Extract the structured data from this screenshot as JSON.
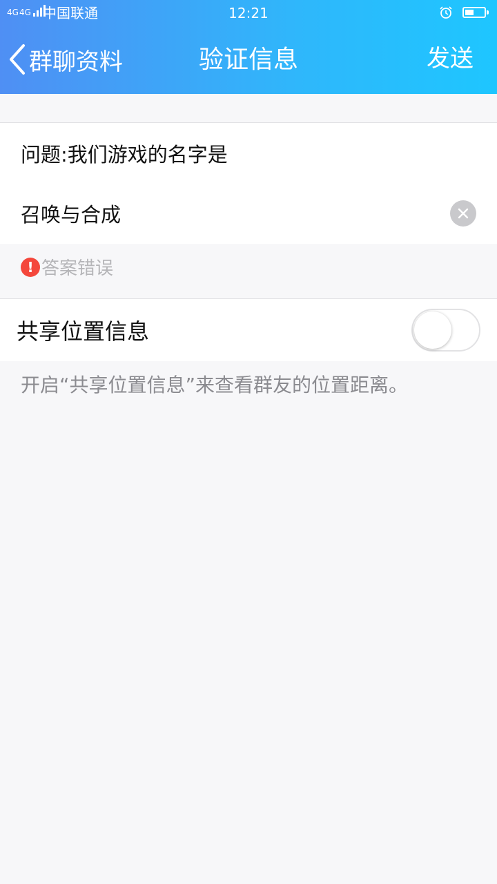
{
  "status_bar": {
    "network": "4G",
    "network2": "4G",
    "carrier": "中国联通",
    "time": "12:21",
    "battery_level": 0.45
  },
  "nav": {
    "back_label": "群聊资料",
    "title": "验证信息",
    "send_label": "发送"
  },
  "form": {
    "question": "问题:我们游戏的名字是",
    "answer": "召唤与合成",
    "error_message": "答案错误"
  },
  "share_location": {
    "label": "共享位置信息",
    "enabled": false,
    "hint": "开启“共享位置信息”来查看群友的位置距离。"
  },
  "colors": {
    "header_start": "#4f8ff4",
    "header_end": "#1ec6ff",
    "error": "#f4473c",
    "page_bg": "#f7f7f9"
  }
}
